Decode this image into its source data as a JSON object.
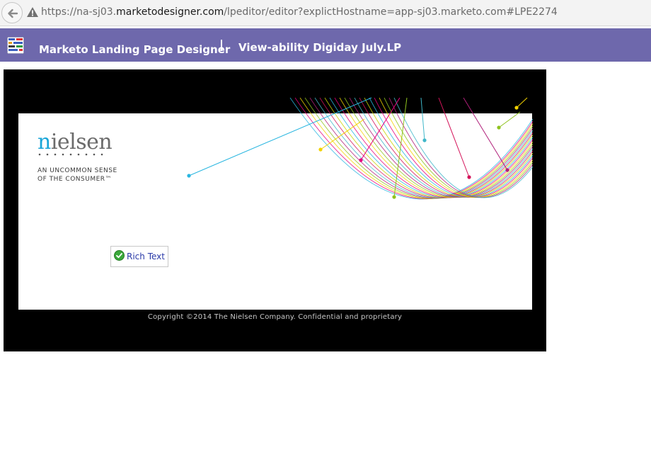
{
  "browser": {
    "url_prefix": "https://na-sj03.",
    "url_domain": "marketodesigner.com",
    "url_rest": "/lpeditor/editor?explictHostname=app-sj03.marketo.com#LPE2274"
  },
  "header": {
    "app_title": "Marketo Landing Page Designer",
    "page_title": "View-ability Digiday July.LP",
    "background": "#6e68ac"
  },
  "landing_page": {
    "logo_first": "n",
    "logo_rest": "ielsen",
    "tagline_line1": "AN UNCOMMON SENSE",
    "tagline_line2": "OF THE CONSUMER™",
    "rich_text_label": "Rich Text",
    "copyright": "Copyright ©2014 The Nielsen Company. Confidential and proprietary",
    "accent": "#1aa6d8"
  }
}
